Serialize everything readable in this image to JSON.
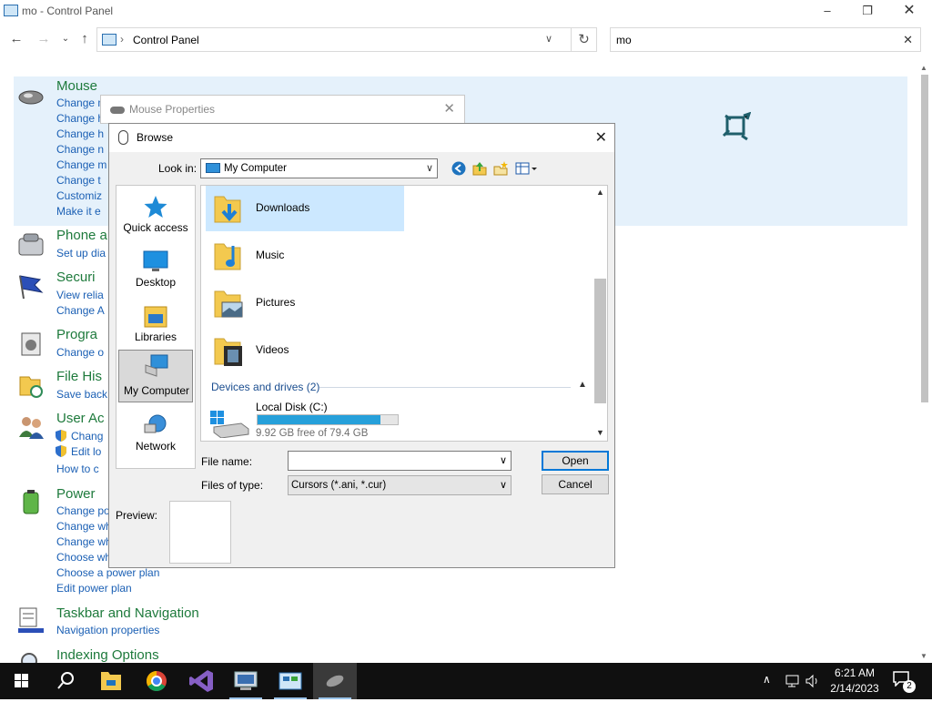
{
  "window": {
    "title": "mo - Control Panel"
  },
  "address": {
    "path": "Control Panel",
    "search_value": "mo"
  },
  "cp_items": [
    {
      "title": "Mouse",
      "links": [
        "Change m",
        "Change h",
        "Change h",
        "Change n",
        "Change m",
        "Change t",
        "Customiz",
        "Make it e"
      ]
    },
    {
      "title": "Phone a",
      "links": [
        "Set up dia"
      ]
    },
    {
      "title": "Securi",
      "links": [
        "View relia",
        "Change A"
      ]
    },
    {
      "title": "Progra",
      "links": [
        "Change o"
      ]
    },
    {
      "title": "File His",
      "links": [
        "Save back"
      ]
    },
    {
      "title": "User Ac",
      "links": [
        "Chang",
        "Edit lo",
        "How to c"
      ]
    },
    {
      "title": "Power",
      "links": [
        "Change po",
        "Change wh",
        "Change wh",
        "Choose wh",
        "Choose a power plan",
        "Edit power plan"
      ]
    },
    {
      "title": "Taskbar and Navigation",
      "links": [
        "Navigation properties"
      ]
    },
    {
      "title": "Indexing Options",
      "links": []
    }
  ],
  "mouse_properties": {
    "title": "Mouse Properties"
  },
  "browse": {
    "title": "Browse",
    "look_in_label": "Look in:",
    "look_in_value": "My Computer",
    "places": [
      "Quick access",
      "Desktop",
      "Libraries",
      "My Computer",
      "Network"
    ],
    "selected_place": "My Computer",
    "folders": [
      "Downloads",
      "Music",
      "Pictures",
      "Videos"
    ],
    "selected_folder": "Downloads",
    "group_header": "Devices and drives (2)",
    "drive": {
      "name": "Local Disk (C:)",
      "free_text": "9.92 GB free of 79.4 GB",
      "used_fraction": 0.875
    },
    "file_name_label": "File name:",
    "file_name_value": "",
    "files_of_type_label": "Files of type:",
    "files_of_type_value": "Cursors (*.ani, *.cur)",
    "open_label": "Open",
    "cancel_label": "Cancel",
    "preview_label": "Preview:"
  },
  "taskbar": {
    "apps": [
      "start",
      "search",
      "file-explorer",
      "chrome",
      "visual-studio",
      "remote-desktop",
      "control-panel",
      "mouse-properties"
    ],
    "time": "6:21 AM",
    "date": "2/14/2023",
    "notification_count": "2"
  },
  "colors": {
    "accent": "#0078d7",
    "link": "#1a5fb4",
    "cp_title": "#1e7a3c",
    "selection": "#cce8ff",
    "drive_fill": "#26a0da"
  }
}
